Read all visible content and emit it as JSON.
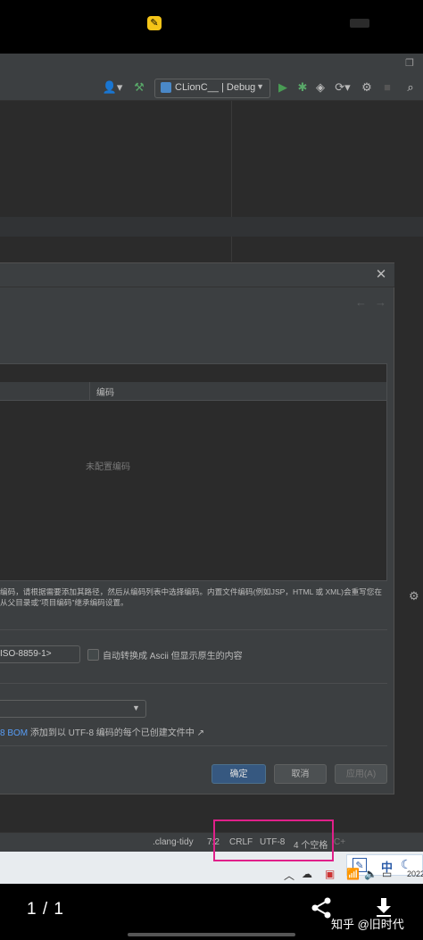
{
  "ide": {
    "run_config": "CLionC__ | Debug",
    "toolbar_icons": [
      "user-icon",
      "build-hammer-icon",
      "run-icon",
      "debug-icon",
      "coverage-icon",
      "profiler-icon",
      "attach-icon",
      "stop-icon",
      "search-icon"
    ]
  },
  "dialog": {
    "table_header_encoding": "编码",
    "table_empty_text": "未配置编码",
    "description_line1": "编码，请根据需要添加其路径，然后从编码列表中选择编码。内置文件编码(例如JSP，HTML 或 XML)会重写您在",
    "description_line2": "从父目录或\"项目编码\"继承编码设置。",
    "charset_value": "ISO-8859-1>",
    "ascii_label": "自动转换成 Ascii 但显示原生的内容",
    "bom_prefix": "8 BOM",
    "bom_text": "添加到以 UTF-8 编码的每个已创建文件中 ↗",
    "ok_label": "确定",
    "cancel_label": "取消",
    "apply_label": "应用(A)"
  },
  "statusbar": {
    "clang_tidy": ".clang-tidy",
    "position": "7:2",
    "line_separator": "CRLF",
    "encoding": "UTF-8",
    "indent": "4 个空格",
    "lang_partial": "C+"
  },
  "tray": {
    "ime_mode": "中",
    "year_partial": "2022"
  },
  "phone": {
    "page_counter": "1 / 1",
    "watermark": "知乎 @旧时代"
  },
  "colors": {
    "highlight_box": "#e0208a",
    "link": "#589df6",
    "primary_button": "#365880"
  }
}
